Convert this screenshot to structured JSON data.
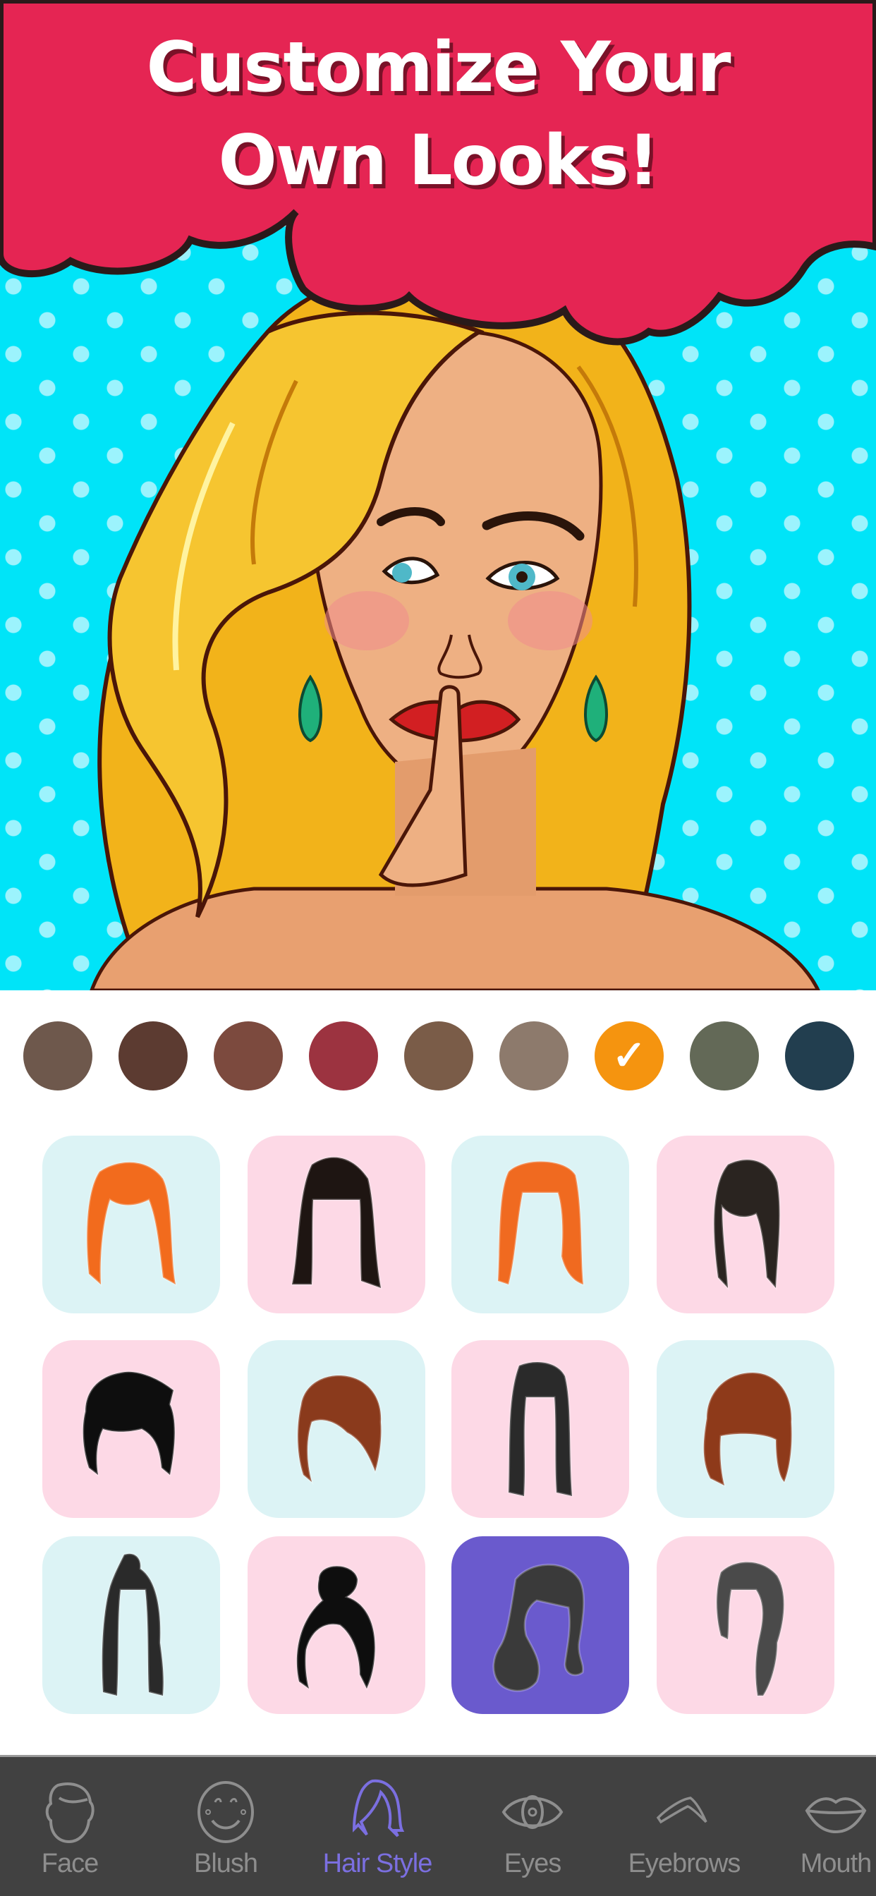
{
  "hero": {
    "headline_line1": "Customize Your",
    "headline_line2": "Own Looks!",
    "banner_color": "#e52553",
    "background_color": "#00e4f8",
    "illustration": "pop-art-woman-shh-gesture"
  },
  "color_palette": {
    "selected_index": 6,
    "swatches": [
      {
        "name": "taupe",
        "color": "#6e584c"
      },
      {
        "name": "dark-brown",
        "color": "#5c3b31"
      },
      {
        "name": "chestnut",
        "color": "#7c4a3e"
      },
      {
        "name": "burgundy",
        "color": "#9c3340"
      },
      {
        "name": "mocha",
        "color": "#7a5c48"
      },
      {
        "name": "ash-brown",
        "color": "#8d7a6c"
      },
      {
        "name": "orange",
        "color": "#f5940f"
      },
      {
        "name": "olive-gray",
        "color": "#636957"
      },
      {
        "name": "navy",
        "color": "#223e4f"
      }
    ],
    "check_glyph": "✓"
  },
  "hair_styles": {
    "selected_index": 10,
    "selected_color": "#6a5acd",
    "items": [
      {
        "name": "orange-long-bangs",
        "bg": "#dcf3f5",
        "hair": "#f26b1d"
      },
      {
        "name": "black-long-bangs",
        "bg": "#fdd9e6",
        "hair": "#1e1512"
      },
      {
        "name": "orange-straight-bob",
        "bg": "#dcf3f5",
        "hair": "#f06a20"
      },
      {
        "name": "black-blonde-highlights",
        "bg": "#fdd9e6",
        "hair": "#2a2420"
      },
      {
        "name": "black-spiky-short",
        "bg": "#fdd9e6",
        "hair": "#0e0e0e"
      },
      {
        "name": "auburn-side-swept",
        "bg": "#dcf3f5",
        "hair": "#8a3a1c"
      },
      {
        "name": "black-white-long-wavy",
        "bg": "#fdd9e6",
        "hair": "#2a2a2a"
      },
      {
        "name": "auburn-layered-bob",
        "bg": "#dcf3f5",
        "hair": "#8e3a1a"
      },
      {
        "name": "black-white-top-knot",
        "bg": "#dcf3f5",
        "hair": "#2a2a2a"
      },
      {
        "name": "black-bun-updo",
        "bg": "#fdd9e6",
        "hair": "#0e0e0e"
      },
      {
        "name": "gray-retro-curls",
        "bg": "#6a5acd",
        "hair": "#3a3a3a"
      },
      {
        "name": "gray-side-braid",
        "bg": "#fdd9e6",
        "hair": "#4a4a4a"
      }
    ]
  },
  "bottom_nav": {
    "active_index": 2,
    "active_color": "#7b6fe0",
    "inactive_color": "#8e8e8e",
    "items": [
      {
        "label": "Face",
        "icon": "face-icon"
      },
      {
        "label": "Blush",
        "icon": "smiley-icon"
      },
      {
        "label": "Hair Style",
        "icon": "hair-icon"
      },
      {
        "label": "Eyes",
        "icon": "eye-icon"
      },
      {
        "label": "Eyebrows",
        "icon": "eyebrow-icon"
      },
      {
        "label": "Mouth",
        "icon": "lips-icon"
      }
    ]
  }
}
